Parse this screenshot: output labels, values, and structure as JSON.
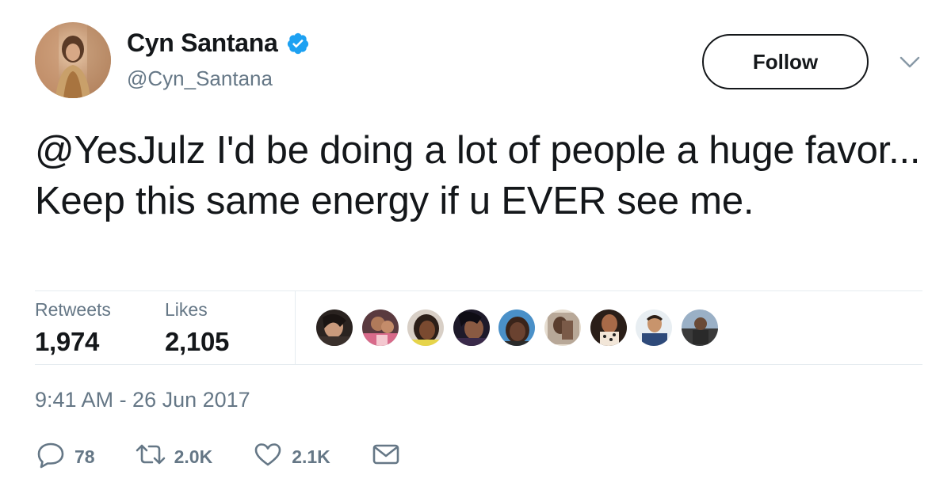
{
  "author": {
    "display_name": "Cyn Santana",
    "handle": "@Cyn_Santana",
    "verified": true,
    "verified_color": "#1da1f2"
  },
  "follow_button": {
    "label": "Follow"
  },
  "tweet": {
    "text": "@YesJulz I'd be doing a lot of people a huge favor... Keep this same energy if u EVER see me."
  },
  "stats": {
    "retweets_label": "Retweets",
    "retweets_value": "1,974",
    "likes_label": "Likes",
    "likes_value": "2,105"
  },
  "liker_avatars": [
    "avatar-1",
    "avatar-2",
    "avatar-3",
    "avatar-4",
    "avatar-5",
    "avatar-6",
    "avatar-7",
    "avatar-8",
    "avatar-9"
  ],
  "timestamp": "9:41 AM - 26 Jun 2017",
  "actions": {
    "reply_count": "78",
    "retweet_count": "2.0K",
    "like_count": "2.1K"
  },
  "icons": [
    "verified-badge-icon",
    "chevron-down-icon",
    "reply-icon",
    "retweet-icon",
    "heart-icon",
    "mail-icon"
  ]
}
